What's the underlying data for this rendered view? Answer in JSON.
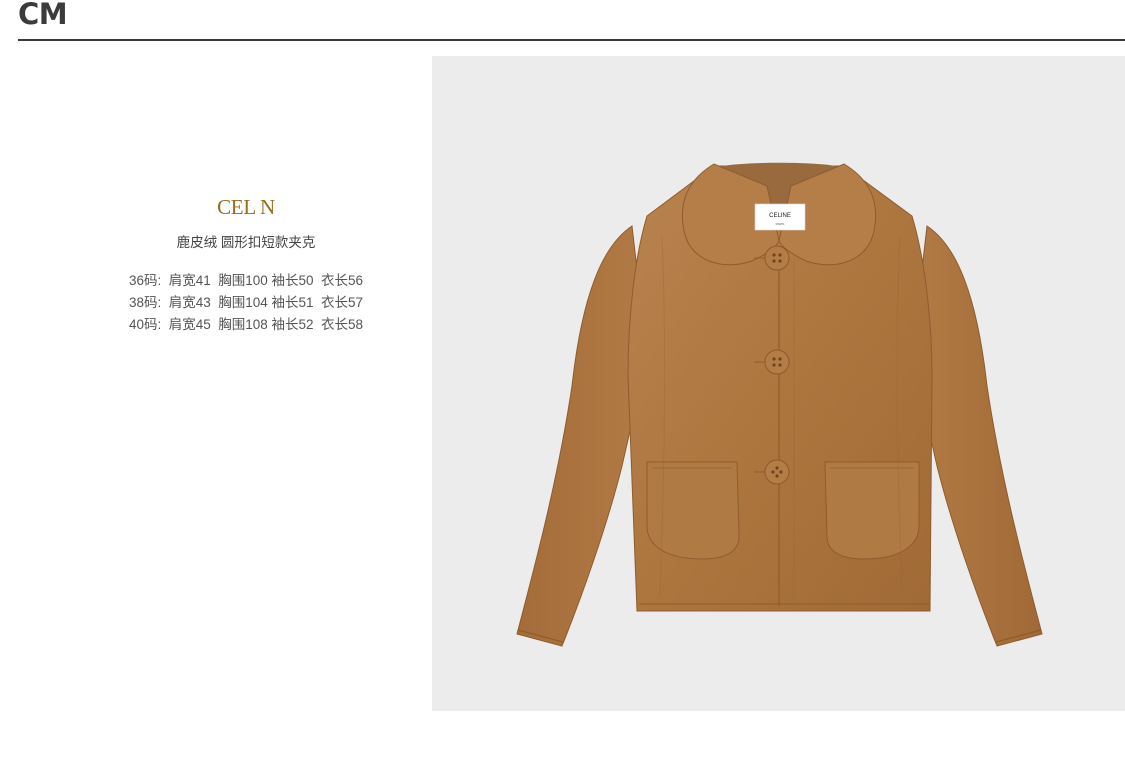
{
  "header": {
    "logo": "CM"
  },
  "product": {
    "brand": "CEL N",
    "name": "鹿皮绒 圆形扣短款夹克",
    "sizes": [
      "36码:  肩宽41  胸围100 袖长50  衣长56",
      "38码:  肩宽43  胸围104 袖长51  衣长57",
      "40码:  肩宽45  胸围108 袖长52  衣长58"
    ],
    "image": {
      "label_text": "CELINE",
      "label_sub": "PARIS",
      "background": "#ececec",
      "garment_color": "#b07a45"
    }
  }
}
